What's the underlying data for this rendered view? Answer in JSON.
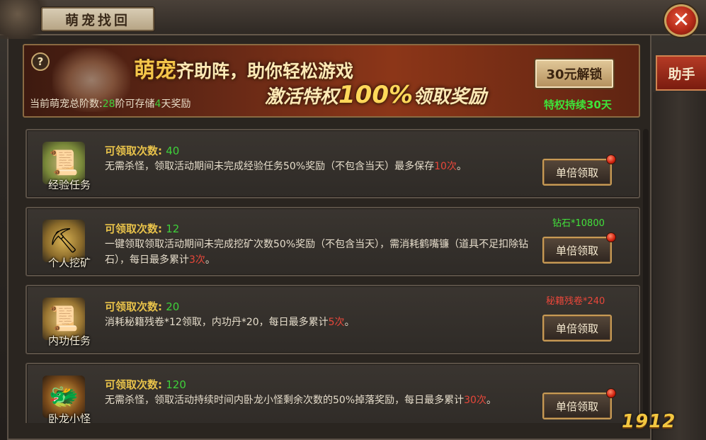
{
  "window": {
    "title": "萌宠找回",
    "close_glyph": "✕",
    "side_tab": "助手"
  },
  "banner": {
    "slogan_highlight": "萌宠",
    "slogan_rest": "齐助阵，助你轻松游戏",
    "slogan2_prefix": "激活特权",
    "slogan2_big": "100%",
    "slogan2_suffix": "领取奖励",
    "store_prefix": "当前萌宠总阶数:",
    "store_level": "28",
    "store_mid": "阶可存储",
    "store_days": "4",
    "store_suffix": "天奖励",
    "unlock_button": "30元解锁",
    "privilege": "特权持续30天",
    "help_glyph": "?"
  },
  "rows": [
    {
      "icon": "exp-scroll-icon",
      "icon_glyph": "📜",
      "label": "经验任务",
      "count_label": "可领取次数:",
      "count": "40",
      "desc": "无需杀怪，领取活动期间未完成经验任务50%奖励（不包含当天）最多保存",
      "desc_red": "10次",
      "desc_tail": "。",
      "cost": "",
      "button": "单倍领取"
    },
    {
      "icon": "pickaxe-icon",
      "icon_glyph": "⛏",
      "label": "个人挖矿",
      "count_label": "可领取次数:",
      "count": "12",
      "desc": "一键领取领取活动期间未完成挖矿次数50%奖励（不包含当天），需消耗鹤嘴镰（道具不足扣除钻石），每日最多累计",
      "desc_red": "3次",
      "desc_tail": "。",
      "cost": "钻石*10800",
      "button": "单倍领取"
    },
    {
      "icon": "internal-skill-scroll-icon",
      "icon_glyph": "📜",
      "label": "内功任务",
      "count_label": "可领取次数:",
      "count": "20",
      "desc": "消耗秘籍残卷*12领取，内功丹*20，每日最多累计",
      "desc_red": "5次",
      "desc_tail": "。",
      "cost": "秘籍残卷*240",
      "button": "单倍领取"
    },
    {
      "icon": "dragon-monster-icon",
      "icon_glyph": "🐲",
      "label": "卧龙小怪",
      "count_label": "可领取次数:",
      "count": "120",
      "desc": "无需杀怪，领取活动持续时间内卧龙小怪剩余次数的50%掉落奖励，每日最多累计",
      "desc_red": "30次",
      "desc_tail": "。",
      "cost": "",
      "button": "单倍领取"
    }
  ],
  "watermark": "1912"
}
